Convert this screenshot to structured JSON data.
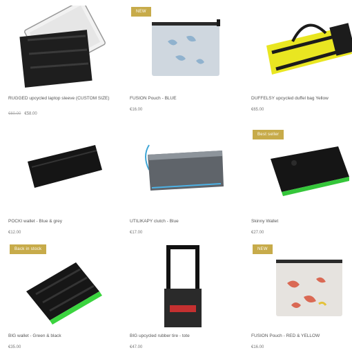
{
  "products": [
    {
      "badge": "",
      "title": "RUGGED upcycled laptop sleeve (CUSTOM SIZE)",
      "old_price": "€60.00",
      "price": "€58.00",
      "image": "laptop-sleeve"
    },
    {
      "badge": "NEW",
      "title": "FUSION Pouch - BLUE",
      "old_price": "",
      "price": "€16.00",
      "image": "pouch-blue"
    },
    {
      "badge": "",
      "title": "DUFFELSY upcycled duffel bag Yellow",
      "old_price": "",
      "price": "€65.00",
      "image": "duffel-yellow"
    },
    {
      "badge": "",
      "title": "POCKI wallet - Blue & grey",
      "old_price": "",
      "price": "€12.00",
      "image": "wallet-black"
    },
    {
      "badge": "",
      "title": "UTILIKAPY clutch - Blue",
      "old_price": "",
      "price": "€17.00",
      "image": "clutch-blue"
    },
    {
      "badge": "Best seller",
      "title": "Skinny Wallet",
      "old_price": "",
      "price": "€27.00",
      "image": "wallet-green"
    },
    {
      "badge": "Back in stock",
      "title": "BIG wallet - Green & black",
      "old_price": "",
      "price": "€35.00",
      "image": "big-wallet-green"
    },
    {
      "badge": "",
      "title": "BIG upcycled rubber tire - tote",
      "old_price": "",
      "price": "€47.00",
      "image": "tote-red"
    },
    {
      "badge": "NEW",
      "title": "FUSION Pouch - RED & YELLOW",
      "old_price": "",
      "price": "€16.00",
      "image": "pouch-red"
    }
  ]
}
